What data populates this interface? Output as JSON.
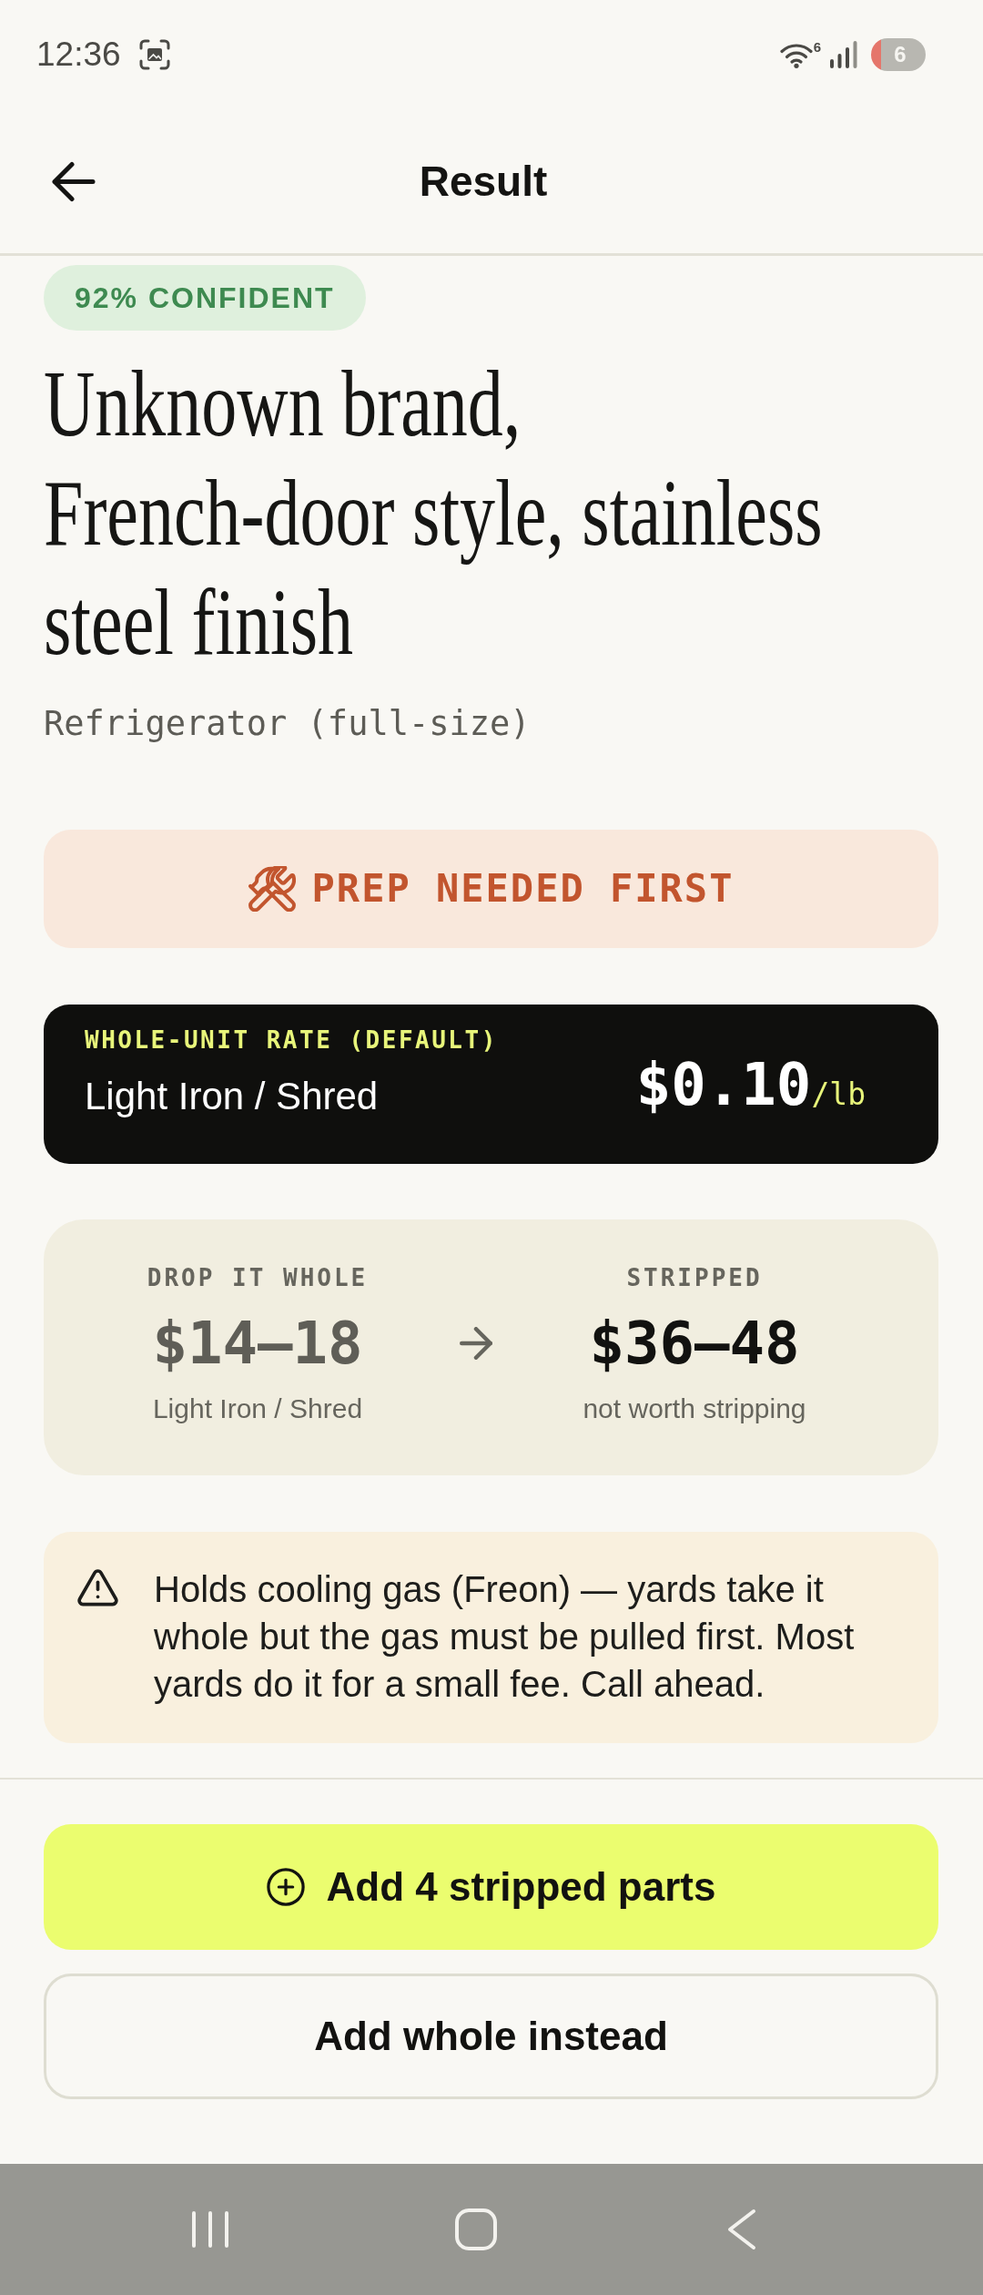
{
  "status_bar": {
    "time": "12:36",
    "wifi_badge": "6",
    "battery": "6"
  },
  "header": {
    "title": "Result"
  },
  "confidence_badge": "92% CONFIDENT",
  "item": {
    "title": "Unknown brand,\nFrench-door style, stainless steel finish",
    "category": "Refrigerator (full-size)"
  },
  "prep_banner": {
    "label": "PREP NEEDED FIRST"
  },
  "rate_card": {
    "label": "WHOLE-UNIT RATE (DEFAULT)",
    "category": "Light Iron / Shred",
    "price": "$0.10",
    "unit": "/lb"
  },
  "comparison": [
    {
      "label": "DROP IT WHOLE",
      "value": "$14–18",
      "note": "Light Iron / Shred",
      "emphasized": false
    },
    {
      "label": "STRIPPED",
      "value": "$36–48",
      "note": "not worth stripping",
      "emphasized": true
    }
  ],
  "warning": {
    "text": "Holds cooling gas (Freon) — yards take it whole but the gas must be pulled first. Most yards do it for a small fee. Call ahead."
  },
  "actions": [
    {
      "kind": "primary",
      "label": "Add 4 stripped parts"
    },
    {
      "kind": "secondary",
      "label": "Add whole instead"
    }
  ]
}
